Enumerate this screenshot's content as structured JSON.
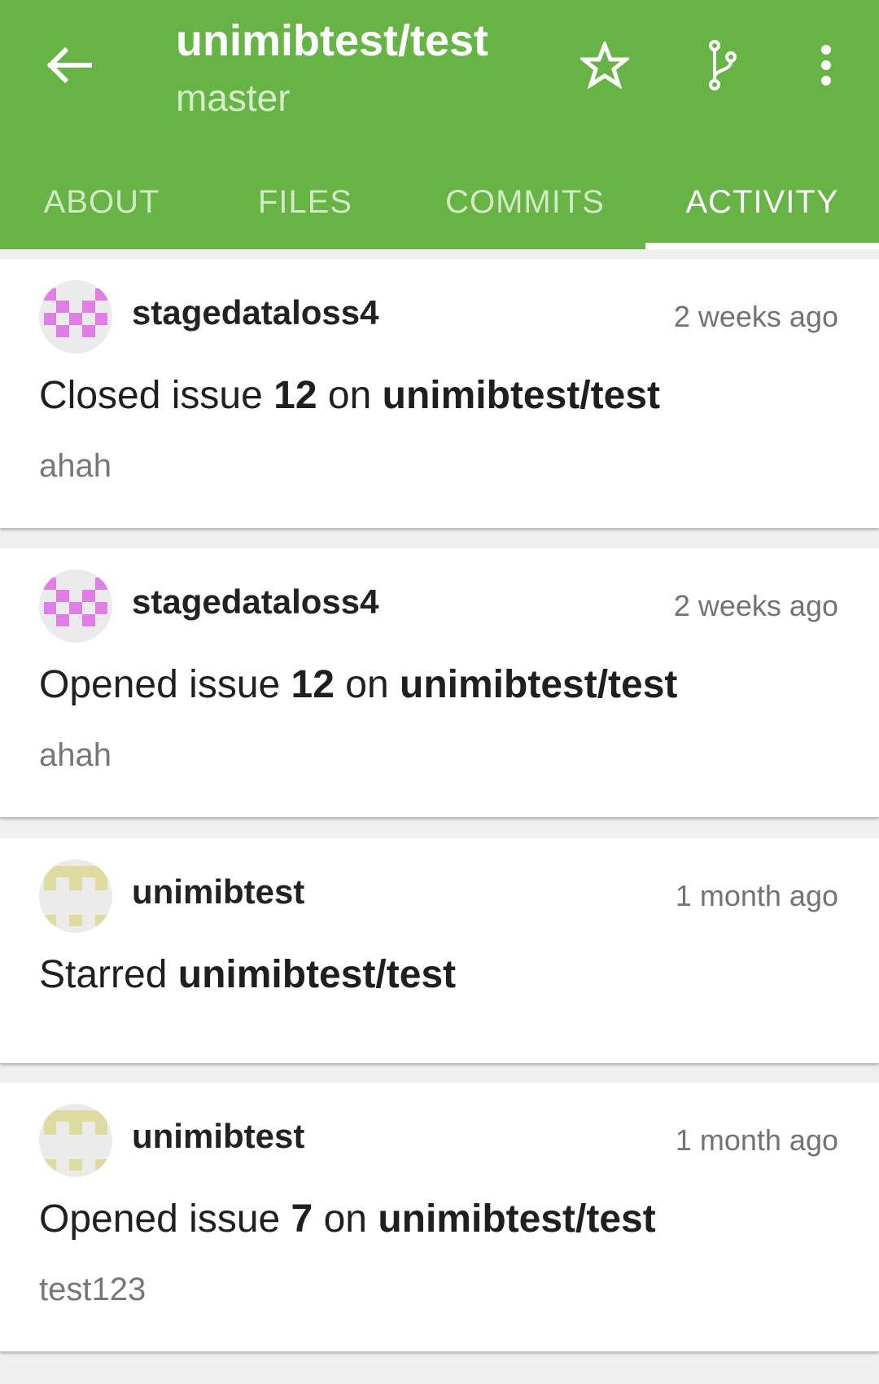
{
  "colors": {
    "primary": "#67b345",
    "tab_inactive": "#d2eac4",
    "avatar_pink": "#e07ee8",
    "avatar_yellow": "#dedba1"
  },
  "appbar": {
    "title": "unimibtest/test",
    "subtitle": "master",
    "icons": [
      "arrow-left-icon",
      "star-outline-icon",
      "source-branch-icon",
      "more-vertical-icon"
    ]
  },
  "tabs": [
    {
      "label": "ABOUT",
      "active": false
    },
    {
      "label": "FILES",
      "active": false
    },
    {
      "label": "COMMITS",
      "active": false
    },
    {
      "label": "ACTIVITY",
      "active": true
    }
  ],
  "events": [
    {
      "user": "stagedataloss4",
      "time": "2 weeks ago",
      "verb": "Closed issue",
      "number": "12",
      "connector": "on",
      "repo": "unimibtest/test",
      "body": "ahah"
    },
    {
      "user": "stagedataloss4",
      "time": "2 weeks ago",
      "verb": "Opened issue",
      "number": "12",
      "connector": "on",
      "repo": "unimibtest/test",
      "body": "ahah"
    },
    {
      "user": "unimibtest",
      "time": "1 month ago",
      "verb": "Starred",
      "repo": "unimibtest/test"
    },
    {
      "user": "unimibtest",
      "time": "1 month ago",
      "verb": "Opened issue",
      "number": "7",
      "connector": "on",
      "repo": "unimibtest/test",
      "body": "test123"
    }
  ]
}
